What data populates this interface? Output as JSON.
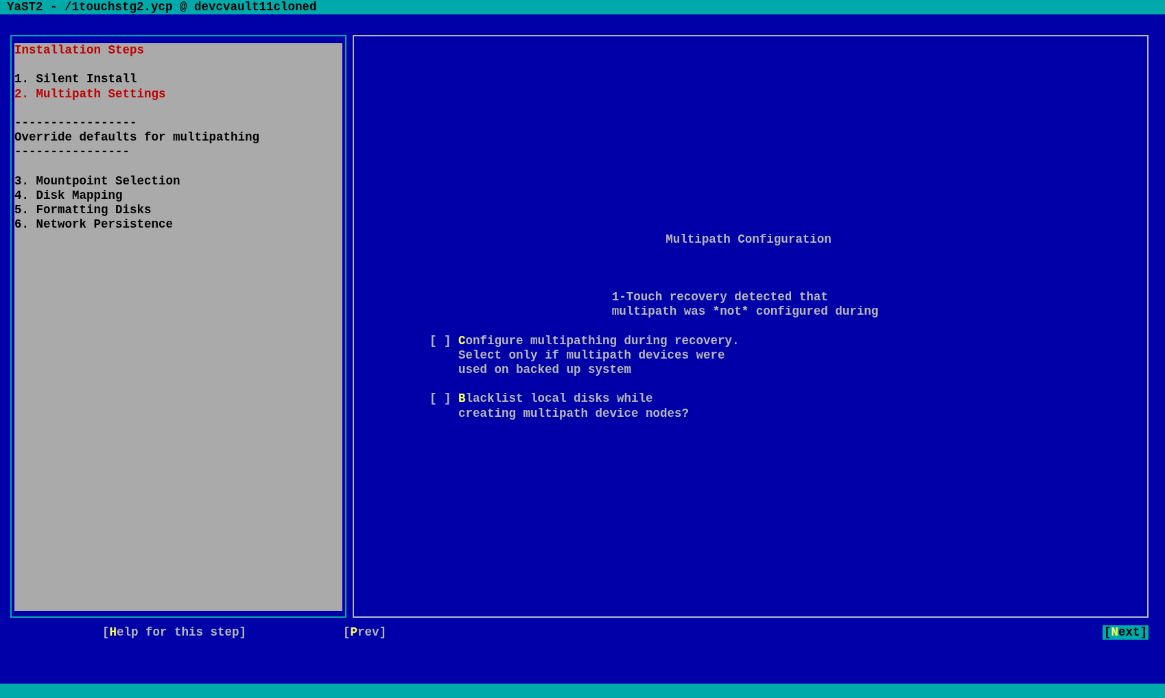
{
  "window": {
    "title": "YaST2 - /1touchstg2.ycp @ devcvault11cloned"
  },
  "steps": {
    "heading": "Installation Steps",
    "items": [
      {
        "text": "1. Silent Install",
        "selected": false
      },
      {
        "text": "2. Multipath Settings",
        "selected": true
      }
    ],
    "note": {
      "rule_above": "-----------------",
      "text": "Override defaults for multipathing",
      "rule_below": "----------------"
    },
    "more_items": [
      {
        "text": "3. Mountpoint Selection",
        "selected": false
      },
      {
        "text": "4. Disk Mapping",
        "selected": false
      },
      {
        "text": "5. Formatting Disks",
        "selected": false
      },
      {
        "text": "6. Network Persistence",
        "selected": false
      }
    ]
  },
  "main": {
    "title": "Multipath Configuration",
    "description": [
      "1-Touch recovery detected that",
      "multipath was *not* configured during"
    ],
    "checkboxes": [
      {
        "box": "[ ]",
        "checked": false,
        "hotkey": "C",
        "lines": [
          "onfigure multipathing during recovery.",
          "Select only if multipath devices were",
          "used on backed up system"
        ]
      },
      {
        "box": "[ ]",
        "checked": false,
        "hotkey": "B",
        "lines": [
          "lacklist local disks while",
          "creating multipath device nodes?"
        ]
      }
    ]
  },
  "buttons": [
    {
      "open": "[",
      "hotkey": "H",
      "rest": "elp for this step",
      "close": "]",
      "focused": false
    },
    {
      "open": "[",
      "hotkey": "P",
      "rest": "rev",
      "close": "]",
      "focused": false
    },
    {
      "open": "[",
      "hotkey": "N",
      "rest": "ext",
      "close": "]",
      "focused": true
    }
  ]
}
